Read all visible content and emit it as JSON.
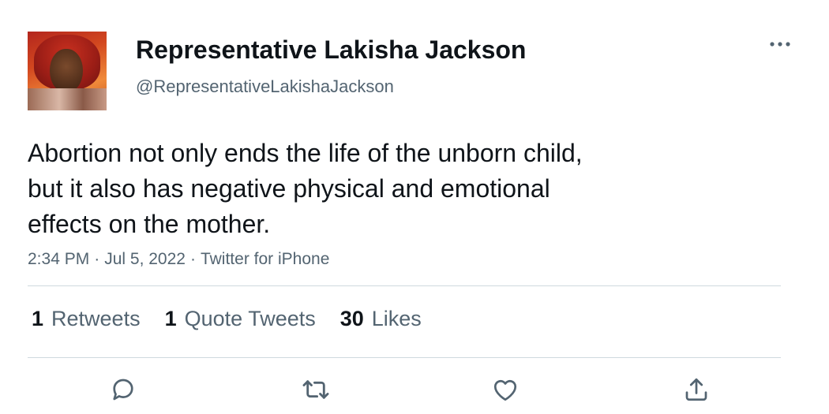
{
  "author": {
    "display_name": "Representative Lakisha Jackson",
    "handle": "@RepresentativeLakishaJackson"
  },
  "tweet": {
    "text": "Abortion not only ends the life of the unborn child,\nbut it also has negative physical and emotional\neffects on the mother.",
    "time": "2:34 PM",
    "separator": "·",
    "date": "Jul 5, 2022",
    "source": "Twitter for iPhone"
  },
  "stats": {
    "retweets_count": "1",
    "retweets_label": "Retweets",
    "quotes_count": "1",
    "quotes_label": "Quote Tweets",
    "likes_count": "30",
    "likes_label": "Likes"
  },
  "icons": {
    "more": "more-horizontal-icon",
    "reply": "reply-icon",
    "retweet": "retweet-icon",
    "like": "heart-icon",
    "share": "share-icon"
  },
  "colors": {
    "primary_text": "#0f1419",
    "secondary_text": "#536471",
    "divider": "#cfd9de"
  }
}
